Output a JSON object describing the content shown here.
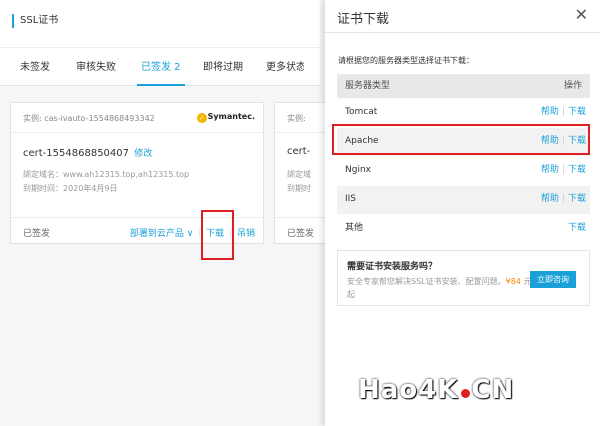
{
  "page": {
    "title": "SSL证书",
    "tabs": [
      {
        "label": "未签发"
      },
      {
        "label": "审核失败"
      },
      {
        "label": "已签发 2"
      },
      {
        "label": "即将过期"
      },
      {
        "label": "更多状态"
      }
    ],
    "card": {
      "instance": "实例: cas-ivauto-1554868493342",
      "brand": "Symantec.",
      "name": "cert-1554868850407",
      "edit_label": "修改",
      "domain_line": "绑定域名：www.ah12315.top,ah12315.top",
      "expire_line": "到期时间：2020年4月9日",
      "status": "已签发",
      "deploy_label": "部署到云产品",
      "download_label": "下载",
      "revoke_label": "吊销"
    },
    "card2": {
      "instance": "实例:",
      "name": "cert-",
      "domain_line": "绑定域",
      "expire_line": "到期时",
      "status": "已签发"
    }
  },
  "drawer": {
    "title": "证书下载",
    "close_icon": "close-icon",
    "description": "请根据您的服务器类型选择证书下载：",
    "table": {
      "headers": [
        "服务器类型",
        "操作"
      ],
      "rows": [
        {
          "server": "Tomcat",
          "help": "帮助",
          "download": "下载"
        },
        {
          "server": "Apache",
          "help": "帮助",
          "download": "下载"
        },
        {
          "server": "Nginx",
          "help": "帮助",
          "download": "下载"
        },
        {
          "server": "IIS",
          "help": "帮助",
          "download": "下载"
        },
        {
          "server": "其他",
          "help": "",
          "download": "下载"
        }
      ]
    },
    "service": {
      "title": "需要证书安装服务吗？",
      "desc_prefix": "安全专家帮您解决SSL证书安装、配置问题。",
      "price": "¥84",
      "desc_suffix": "元起",
      "button": "立即咨询"
    }
  },
  "watermark": {
    "left": "Hao4K",
    "right": "CN"
  },
  "colors": {
    "accent": "#1aa0d8",
    "highlight": "#e02020",
    "price": "#f08a00"
  }
}
